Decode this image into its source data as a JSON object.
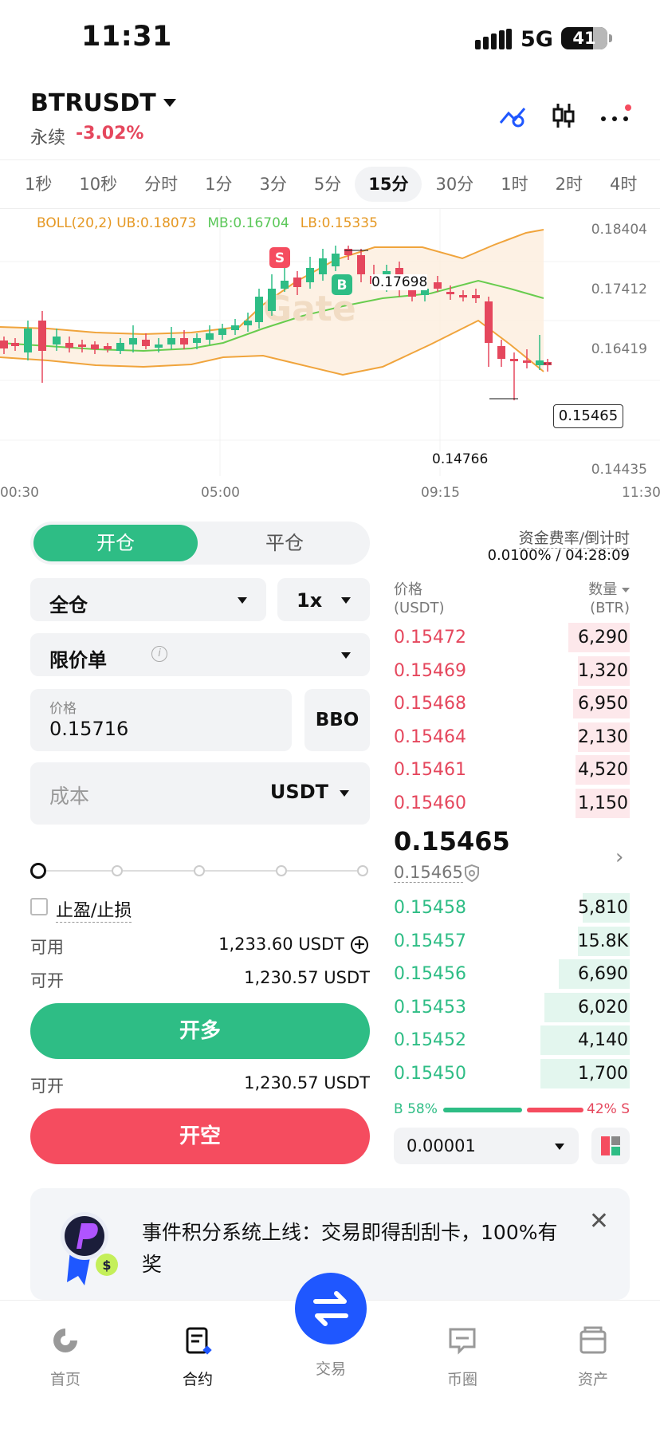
{
  "status_bar": {
    "time": "11:31",
    "network": "5G",
    "battery": "41"
  },
  "header": {
    "pair": "BTRUSDT",
    "contract_type": "永续",
    "change": "-3.02%"
  },
  "intervals": [
    "1秒",
    "10秒",
    "分时",
    "1分",
    "3分",
    "5分",
    "15分",
    "30分",
    "1时",
    "2时",
    "4时"
  ],
  "active_interval": "15分",
  "chart": {
    "boll_label": "BOLL(20,2)",
    "ub": "UB:0.18073",
    "mb": "MB:0.16704",
    "lb": "LB:0.15335",
    "price_ticks": [
      "0.18404",
      "0.17412",
      "0.16419",
      "0.15465",
      "0.14435"
    ],
    "time_ticks": [
      "00:30",
      "05:00",
      "09:15",
      "11:30"
    ],
    "high_annot": "0.17698",
    "low_annot": "0.14766",
    "current_price": "0.15465",
    "marker_s": "S",
    "marker_b": "B",
    "watermark": "Gate",
    "colors": {
      "up": "#2ebd85",
      "down": "#e5475d",
      "ub_lb": "#f0a43c",
      "mb": "#68cc4e",
      "band_fill": "#fdeedd"
    }
  },
  "trade": {
    "open_tab": "开仓",
    "close_tab": "平仓",
    "margin_mode": "全仓",
    "leverage": "1x",
    "order_type": "限价单",
    "price_label": "价格",
    "price_value": "0.15716",
    "bbo": "BBO",
    "cost_placeholder": "成本",
    "cost_unit": "USDT",
    "tpsl": "止盈/止损",
    "available_label": "可用",
    "available_value": "1,233.60 USDT",
    "can_open_label": "可开",
    "can_open_long": "1,230.57 USDT",
    "long_btn": "开多",
    "can_open_short": "1,230.57 USDT",
    "short_btn": "开空"
  },
  "orderbook": {
    "funding_label": "资金费率/倒计时",
    "funding_value": "0.0100% / 04:28:09",
    "price_header": "价格",
    "price_unit": "(USDT)",
    "qty_header": "数量",
    "qty_unit": "(BTR)",
    "asks": [
      {
        "price": "0.15472",
        "qty": "6,290",
        "depth": 0.26
      },
      {
        "price": "0.15469",
        "qty": "1,320",
        "depth": 0.22
      },
      {
        "price": "0.15468",
        "qty": "6,950",
        "depth": 0.24
      },
      {
        "price": "0.15464",
        "qty": "2,130",
        "depth": 0.22
      },
      {
        "price": "0.15461",
        "qty": "4,520",
        "depth": 0.23
      },
      {
        "price": "0.15460",
        "qty": "1,150",
        "depth": 0.23
      }
    ],
    "last_price": "0.15465",
    "mark_price": "0.15465",
    "bids": [
      {
        "price": "0.15458",
        "qty": "5,810",
        "depth": 0.2
      },
      {
        "price": "0.15457",
        "qty": "15.8K",
        "depth": 0.22
      },
      {
        "price": "0.15456",
        "qty": "6,690",
        "depth": 0.3
      },
      {
        "price": "0.15453",
        "qty": "6,020",
        "depth": 0.36
      },
      {
        "price": "0.15452",
        "qty": "4,140",
        "depth": 0.38
      },
      {
        "price": "0.15450",
        "qty": "1,700",
        "depth": 0.38
      }
    ],
    "buy_ratio": "B 58%",
    "sell_ratio": "42% S",
    "buy_pct": 0.58,
    "precision": "0.00001"
  },
  "banner": {
    "text": "事件积分系统上线：交易即得刮刮卡，100%有奖"
  },
  "nav": {
    "home": "首页",
    "contract": "合约",
    "trade": "交易",
    "feed": "币圈",
    "assets": "资产"
  }
}
